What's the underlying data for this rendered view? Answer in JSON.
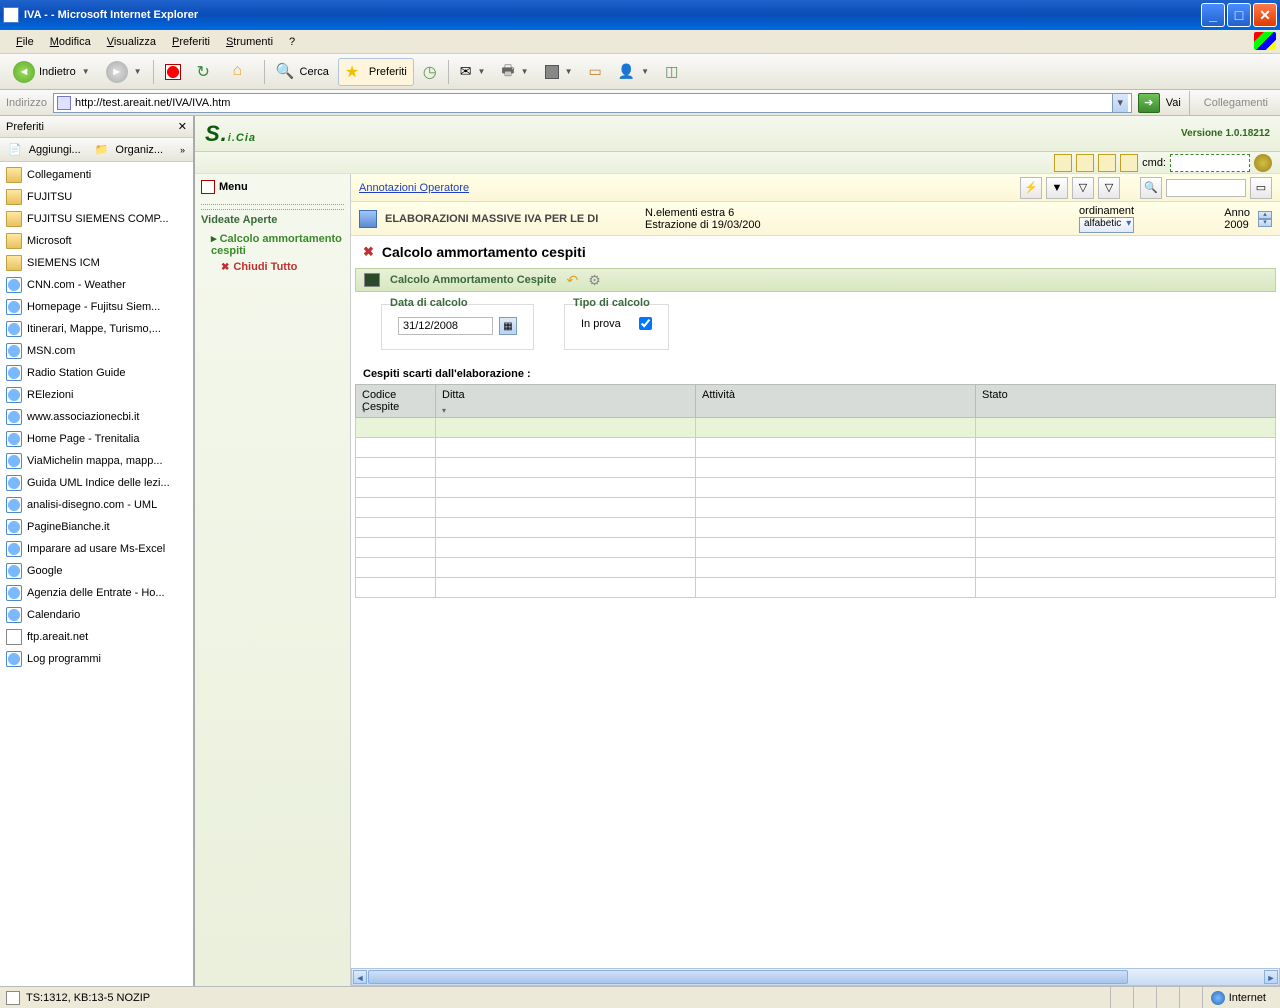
{
  "window": {
    "title": "IVA - - Microsoft Internet Explorer"
  },
  "menubar": {
    "file": "File",
    "modifica": "Modifica",
    "visualizza": "Visualizza",
    "preferiti": "Preferiti",
    "strumenti": "Strumenti",
    "help": "?"
  },
  "toolbar": {
    "back": "Indietro",
    "search": "Cerca",
    "favorites": "Preferiti"
  },
  "addressbar": {
    "label": "Indirizzo",
    "url": "http://test.areait.net/IVA/IVA.htm",
    "go": "Vai",
    "links": "Collegamenti"
  },
  "favpanel": {
    "title": "Preferiti",
    "add": "Aggiungi...",
    "organize": "Organiz...",
    "items": [
      {
        "type": "folder",
        "label": "Collegamenti"
      },
      {
        "type": "folder",
        "label": "FUJITSU"
      },
      {
        "type": "folder",
        "label": "FUJITSU SIEMENS COMP..."
      },
      {
        "type": "folder",
        "label": "Microsoft"
      },
      {
        "type": "folder",
        "label": "SIEMENS ICM"
      },
      {
        "type": "ie",
        "label": "CNN.com - Weather"
      },
      {
        "type": "ie",
        "label": "Homepage - Fujitsu Siem..."
      },
      {
        "type": "ie",
        "label": "Itinerari, Mappe, Turismo,..."
      },
      {
        "type": "ie",
        "label": "MSN.com"
      },
      {
        "type": "ie",
        "label": "Radio Station Guide"
      },
      {
        "type": "ie",
        "label": "RElezioni"
      },
      {
        "type": "ie",
        "label": "www.associazionecbi.it"
      },
      {
        "type": "ie",
        "label": "Home Page - Trenitalia"
      },
      {
        "type": "ie",
        "label": "ViaMichelin  mappa, mapp..."
      },
      {
        "type": "ie",
        "label": "Guida UML Indice delle lezi..."
      },
      {
        "type": "ie",
        "label": "analisi-disegno.com - UML"
      },
      {
        "type": "ie",
        "label": "PagineBianche.it"
      },
      {
        "type": "ie",
        "label": "Imparare ad usare Ms-Excel"
      },
      {
        "type": "ie",
        "label": "Google"
      },
      {
        "type": "ie",
        "label": "Agenzia delle Entrate - Ho..."
      },
      {
        "type": "ie",
        "label": "Calendario"
      },
      {
        "type": "page",
        "label": "ftp.areait.net"
      },
      {
        "type": "ie",
        "label": "Log programmi"
      }
    ]
  },
  "app": {
    "version": "Versione 1.0.18212",
    "cmd_label": "cmd:",
    "menu": "Menu",
    "videate": "Videate Aperte",
    "navitem": "Calcolo ammortamento cespiti",
    "closeall": "Chiudi Tutto",
    "annotazioni": "Annotazioni Operatore",
    "elab": "ELABORAZIONI MASSIVE IVA PER LE DI",
    "ne_label": "N.elementi estra",
    "ne_val": "6",
    "estr_label": "Estrazione di",
    "estr_val": "19/03/200",
    "ord_label": "ordinament",
    "ord_val": "alfabetic",
    "anno_label": "Anno",
    "anno_val": "2009",
    "page_title": "Calcolo ammortamento cespiti",
    "sub_title": "Calcolo Ammortamento Cespite",
    "data_label": "Data di calcolo",
    "data_val": "31/12/2008",
    "tipo_label": "Tipo di calcolo",
    "inprova": "In prova",
    "table_title": "Cespiti scarti dall'elaborazione :",
    "cols": {
      "codice": "Codice Cespite",
      "ditta": "Ditta",
      "attivita": "Attività",
      "stato": "Stato"
    }
  },
  "status": {
    "left": "TS:1312, KB:13-5 NOZIP",
    "zone": "Internet"
  }
}
